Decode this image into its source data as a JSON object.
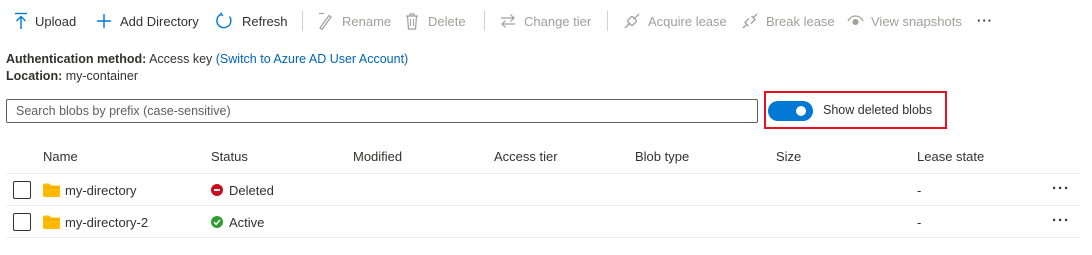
{
  "toolbar": {
    "upload": "Upload",
    "add_directory": "Add Directory",
    "refresh": "Refresh",
    "rename": "Rename",
    "delete": "Delete",
    "change_tier": "Change tier",
    "acquire_lease": "Acquire lease",
    "break_lease": "Break lease",
    "view_snapshots": "View snapshots",
    "more": "···"
  },
  "info": {
    "auth_label": "Authentication method:",
    "auth_value": "Access key",
    "auth_link": "(Switch to Azure AD User Account)",
    "location_label": "Location:",
    "location_value": "my-container"
  },
  "search": {
    "placeholder": "Search blobs by prefix (case-sensitive)"
  },
  "toggle": {
    "label": "Show deleted blobs",
    "on": true
  },
  "table": {
    "columns": [
      "Name",
      "Status",
      "Modified",
      "Access tier",
      "Blob type",
      "Size",
      "Lease state"
    ],
    "rows": [
      {
        "name": "my-directory",
        "status": "Deleted",
        "modified": "",
        "access_tier": "",
        "blob_type": "",
        "size": "",
        "lease_state": "-",
        "more": "···"
      },
      {
        "name": "my-directory-2",
        "status": "Active",
        "modified": "",
        "access_tier": "",
        "blob_type": "",
        "size": "",
        "lease_state": "-",
        "more": "···"
      }
    ]
  },
  "colors": {
    "accent": "#0078d4",
    "highlight_border": "#e81123",
    "deleted": "#c50f1f",
    "active": "#2e9e2e",
    "folder": "#ffb900"
  }
}
